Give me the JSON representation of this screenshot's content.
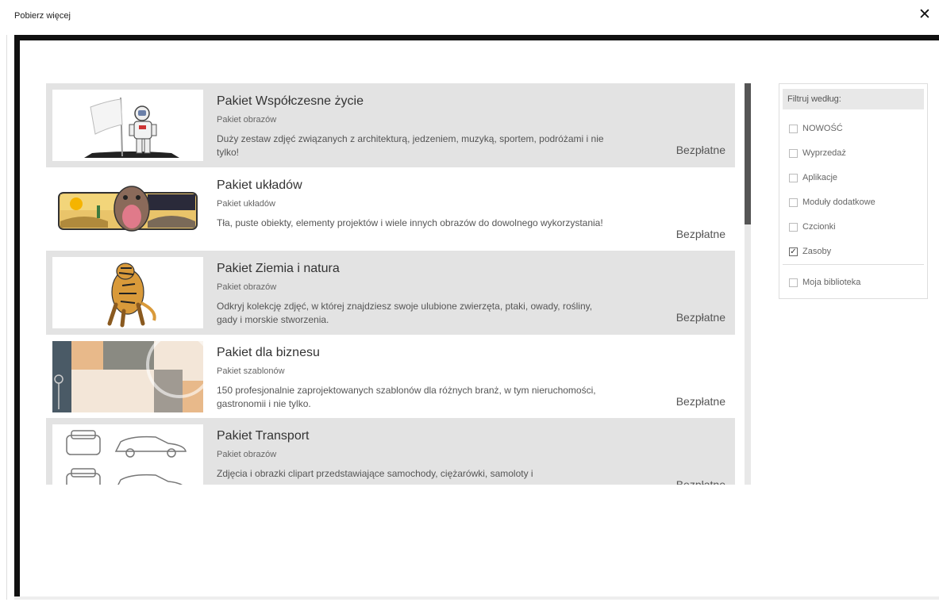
{
  "window": {
    "title": "Pobierz więcej",
    "close_glyph": "✕"
  },
  "items": [
    {
      "title": "Pakiet Współczesne życie",
      "type": "Pakiet obrazów",
      "description": "Duży zestaw zdjęć związanych z architekturą, jedzeniem, muzyką, sportem, podróżami i nie tylko!",
      "price": "Bezpłatne",
      "thumb_icon": "astronaut-flag-icon"
    },
    {
      "title": "Pakiet układów",
      "type": "Pakiet układów",
      "description": "Tła, puste obiekty, elementy projektów i wiele innych obrazów do dowolnego wykorzystania!",
      "price": "Bezpłatne",
      "thumb_icon": "desert-monster-icon"
    },
    {
      "title": "Pakiet Ziemia i natura",
      "type": "Pakiet obrazów",
      "description": "Odkryj kolekcję zdjęć, w której znajdziesz swoje ulubione zwierzęta, ptaki, owady, rośliny, gady i morskie stworzenia.",
      "price": "Bezpłatne",
      "thumb_icon": "tiger-icon"
    },
    {
      "title": "Pakiet dla biznesu",
      "type": "Pakiet szablonów",
      "description": "150 profesjonalnie zaprojektowanych szablonów dla różnych branż, w tym nieruchomości, gastronomii i nie tylko.",
      "price": "Bezpłatne",
      "thumb_icon": "business-template-icon"
    },
    {
      "title": "Pakiet Transport",
      "type": "Pakiet obrazów",
      "description": "Zdjęcia i obrazki clipart przedstawiające samochody, ciężarówki, samoloty i",
      "price": "Bezpłatne",
      "thumb_icon": "cars-icon"
    }
  ],
  "scroll": {
    "position_fraction": 0.0
  },
  "filter": {
    "header": "Filtruj według:",
    "options": [
      {
        "label": "NOWOŚĆ",
        "checked": false
      },
      {
        "label": "Wyprzedaż",
        "checked": false
      },
      {
        "label": "Aplikacje",
        "checked": false
      },
      {
        "label": "Moduły dodatkowe",
        "checked": false
      },
      {
        "label": "Czcionki",
        "checked": false
      },
      {
        "label": "Zasoby",
        "checked": true
      }
    ],
    "library": {
      "label": "Moja biblioteka",
      "checked": false
    }
  }
}
